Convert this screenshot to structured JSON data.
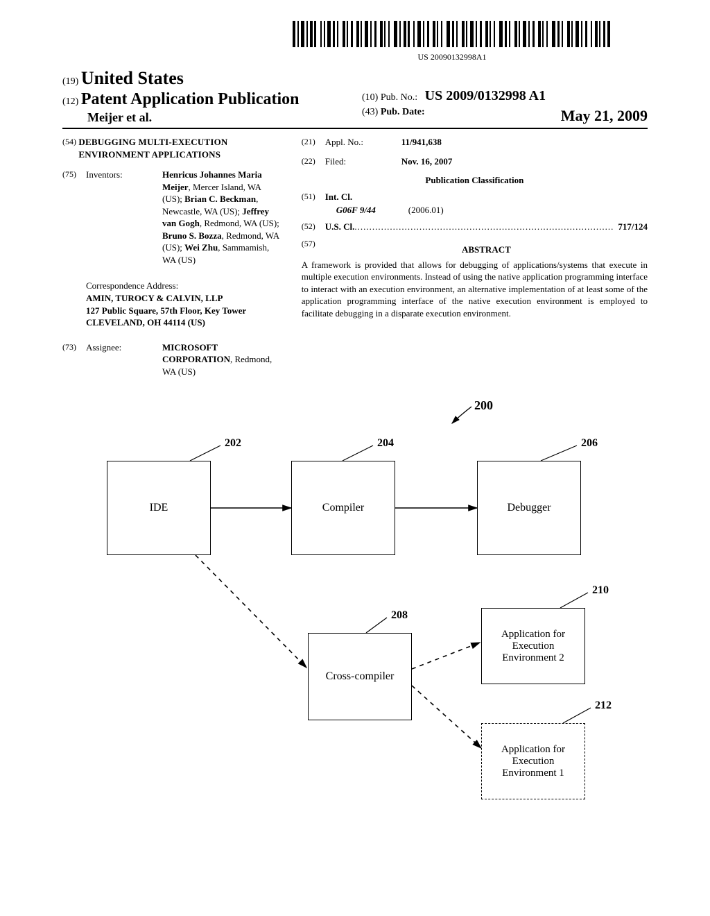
{
  "barcode_text": "US 20090132998A1",
  "header": {
    "l19_prefix": "(19)",
    "l19_country": "United States",
    "l12_prefix": "(12)",
    "l12_title": "Patent Application Publication",
    "authors": "Meijer et al.",
    "l10_prefix": "(10)",
    "l10_label": "Pub. No.:",
    "l10_value": "US 2009/0132998 A1",
    "l43_prefix": "(43)",
    "l43_label": "Pub. Date:",
    "l43_value": "May 21, 2009"
  },
  "left": {
    "n54": "(54)",
    "invention_title": "DEBUGGING MULTI-EXECUTION ENVIRONMENT APPLICATIONS",
    "n75": "(75)",
    "inventors_label": "Inventors:",
    "inventors_html": "Henricus Johannes Maria Meijer, Mercer Island, WA (US); Brian C. Beckman, Newcastle, WA (US); Jeffrey van Gogh, Redmond, WA (US); Bruno S. Bozza, Redmond, WA (US); Wei Zhu, Sammamish, WA (US)",
    "inventors_b1": "Henricus Johannes Maria Meijer",
    "inventors_r1": ", Mercer Island, WA (US); ",
    "inventors_b2": "Brian C. Beckman",
    "inventors_r2": ", Newcastle, WA (US); ",
    "inventors_b3": "Jeffrey van Gogh",
    "inventors_r3": ", Redmond, WA (US); ",
    "inventors_b4": "Bruno S. Bozza",
    "inventors_r4": ", Redmond, WA (US); ",
    "inventors_b5": "Wei Zhu",
    "inventors_r5": ", Sammamish, WA (US)",
    "corr_label": "Correspondence Address:",
    "corr_l1": "AMIN, TUROCY & CALVIN, LLP",
    "corr_l2": "127 Public Square, 57th Floor, Key Tower",
    "corr_l3": "CLEVELAND, OH 44114 (US)",
    "n73": "(73)",
    "assignee_label": "Assignee:",
    "assignee_b": "MICROSOFT CORPORATION",
    "assignee_r": ", Redmond, WA (US)"
  },
  "right": {
    "n21": "(21)",
    "appl_label": "Appl. No.:",
    "appl_value": "11/941,638",
    "n22": "(22)",
    "filed_label": "Filed:",
    "filed_value": "Nov. 16, 2007",
    "pub_class_head": "Publication Classification",
    "n51": "(51)",
    "intcl_label": "Int. Cl.",
    "intcl_code": "G06F  9/44",
    "intcl_date": "(2006.01)",
    "n52": "(52)",
    "uscl_label": "U.S. Cl.",
    "uscl_value": "717/124",
    "n57": "(57)",
    "abstract_head": "ABSTRACT",
    "abstract_body": "A framework is provided that allows for debugging of applications/systems that execute in multiple execution environments. Instead of using the native application programming interface to interact with an execution environment, an alternative implementation of at least some of the application programming interface of the native execution environment is employed to facilitate debugging in a disparate execution environment."
  },
  "diagram": {
    "ref200": "200",
    "ref202": "202",
    "ref204": "204",
    "ref206": "206",
    "ref208": "208",
    "ref210": "210",
    "ref212": "212",
    "box_ide": "IDE",
    "box_compiler": "Compiler",
    "box_debugger": "Debugger",
    "box_cross": "Cross-compiler",
    "box_app2": "Application for Execution Environment 2",
    "box_app1": "Application for Execution Environment 1"
  }
}
